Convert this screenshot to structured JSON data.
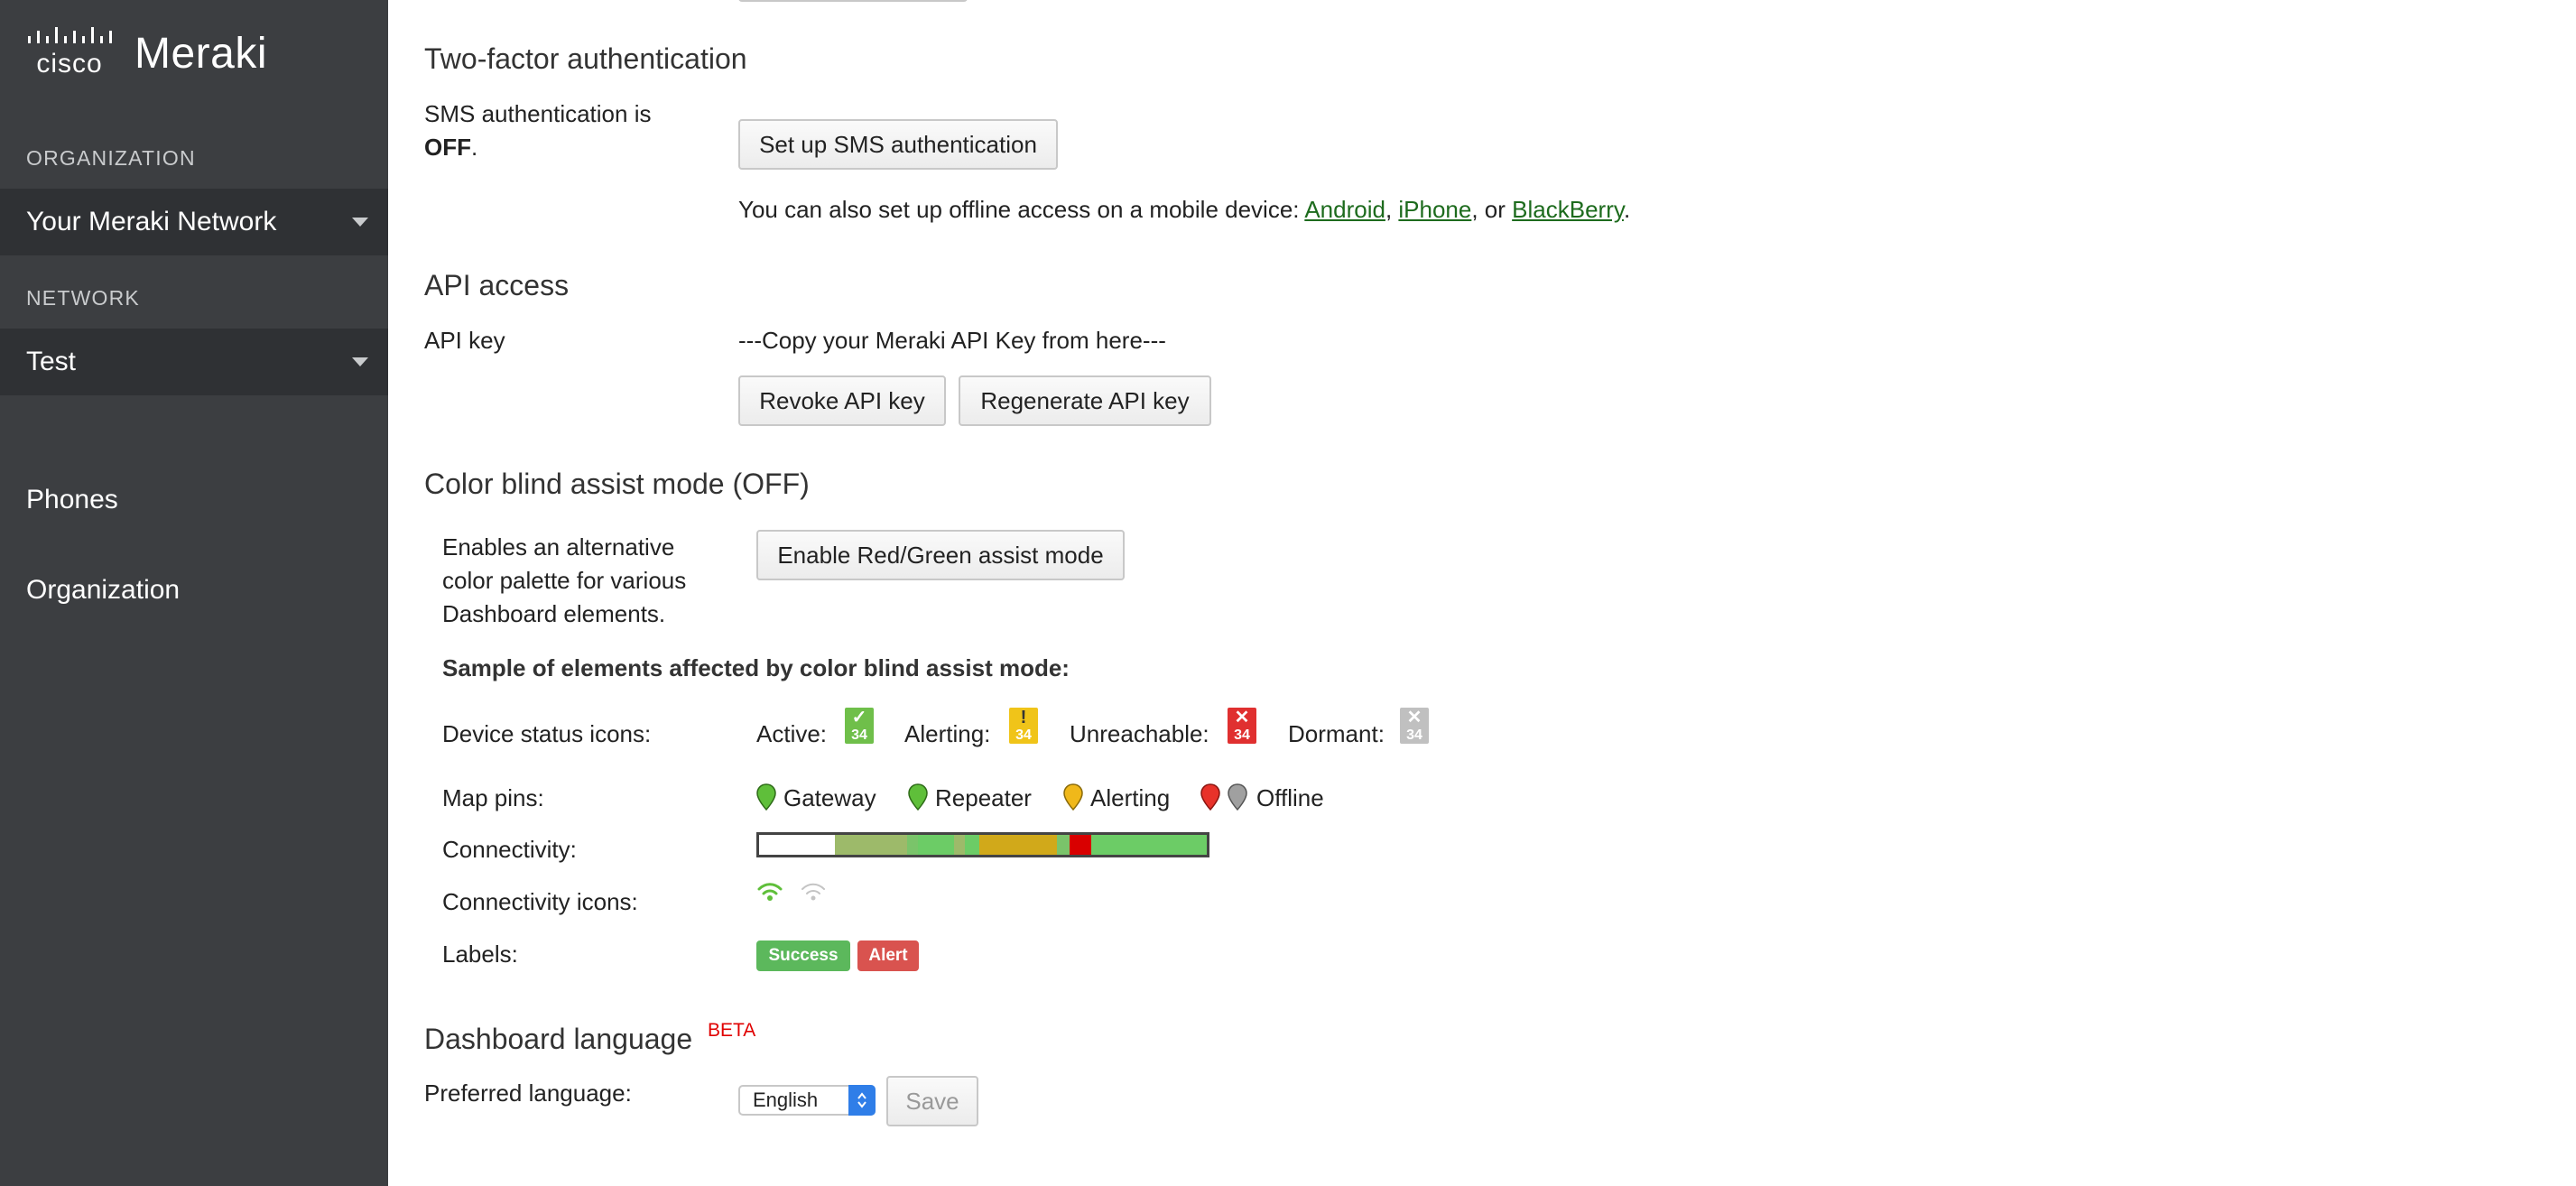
{
  "brand": {
    "cisco": "cisco",
    "product": "Meraki"
  },
  "sidebar": {
    "org_label": "ORGANIZATION",
    "org_value": "Your Meraki Network",
    "network_label": "NETWORK",
    "network_value": "Test",
    "nav": [
      {
        "label": "Phones"
      },
      {
        "label": "Organization"
      }
    ]
  },
  "twofactor": {
    "title": "Two-factor authentication",
    "sms_status_prefix": "SMS authentication is",
    "sms_status_value": "OFF",
    "sms_status_suffix": ".",
    "setup_button": "Set up SMS authentication",
    "offline_text": "You can also set up offline access on a mobile device: ",
    "link_android": "Android",
    "link_iphone": "iPhone",
    "link_blackberry": "BlackBerry",
    "sep1": ", ",
    "sep2": ", or ",
    "end": "."
  },
  "api": {
    "title": "API access",
    "key_label": "API key",
    "key_value": "---Copy your Meraki API Key from here---",
    "revoke_button": "Revoke API key",
    "regenerate_button": "Regenerate API key"
  },
  "colorblind": {
    "title": "Color blind assist mode (OFF)",
    "desc_line1": "Enables an alternative",
    "desc_line2": "color palette for various",
    "desc_line3": "Dashboard elements.",
    "enable_button": "Enable Red/Green assist mode",
    "sample_heading": "Sample of elements affected by color blind assist mode:",
    "device_status_label": "Device status icons:",
    "status_active": "Active:",
    "status_alerting": "Alerting:",
    "status_unreachable": "Unreachable:",
    "status_dormant": "Dormant:",
    "status_number": "34",
    "map_pins_label": "Map pins:",
    "pin_gateway": "Gateway",
    "pin_repeater": "Repeater",
    "pin_alerting": "Alerting",
    "pin_offline": "Offline",
    "connectivity_label": "Connectivity:",
    "connectivity_icons_label": "Connectivity icons:",
    "labels_label": "Labels:",
    "label_success": "Success",
    "label_alert": "Alert"
  },
  "language": {
    "title": "Dashboard language",
    "beta": "BETA",
    "preferred_label": "Preferred language:",
    "selected": "English",
    "save_button": "Save"
  },
  "colors": {
    "sidebar_bg": "#3c3e41",
    "link": "#1d6b1d",
    "success": "#5cb85c",
    "alert": "#d9534f",
    "active": "#6fbf4a",
    "alerting": "#f0c419",
    "unreachable": "#e03030",
    "dormant": "#c0c0c0"
  }
}
